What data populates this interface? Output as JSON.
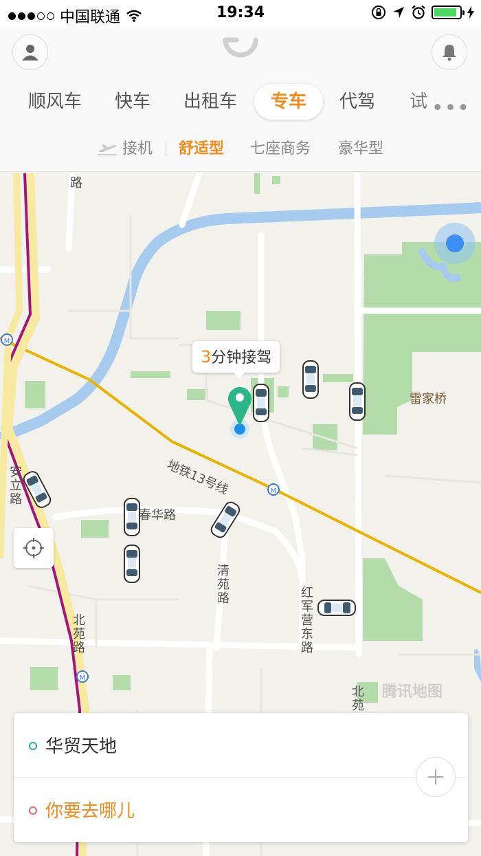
{
  "status_bar": {
    "carrier": "中国联通",
    "time": "19:34",
    "battery_level": 0.9
  },
  "header": {
    "ride_tabs": [
      {
        "label": "顺风车"
      },
      {
        "label": "快车"
      },
      {
        "label": "出租车"
      },
      {
        "label": "专车",
        "active": true
      },
      {
        "label": "代驾"
      },
      {
        "label": "试驾"
      }
    ],
    "sub_tabs": [
      {
        "label": "接机"
      },
      {
        "label": "舒适型",
        "active": true
      },
      {
        "label": "七座商务"
      },
      {
        "label": "豪华型"
      }
    ],
    "more_icon": "more-dots-icon"
  },
  "map": {
    "eta_number": "3",
    "eta_text": "分钟接驾",
    "labels": {
      "chunhua_road": "春华路",
      "subway_line": "地铁13号线",
      "leijia_bridge": "雷家桥",
      "anli_road": "安立路",
      "qingyuan_road": "清苑路",
      "hongjun_road": "红军营东路",
      "beiyuan_road": "北苑路",
      "beiyuan_short": "北苑",
      "top_road": "路"
    },
    "watermark": "腾讯地图",
    "colors": {
      "river": "#a6cbee",
      "park": "#b4dcaa",
      "subway": "#e8b400",
      "metro_ring": "#a0157e",
      "pin": "#2bb589",
      "accent": "#f28b1a"
    }
  },
  "route_panel": {
    "from": "华贸天地",
    "to": "你要去哪儿"
  }
}
